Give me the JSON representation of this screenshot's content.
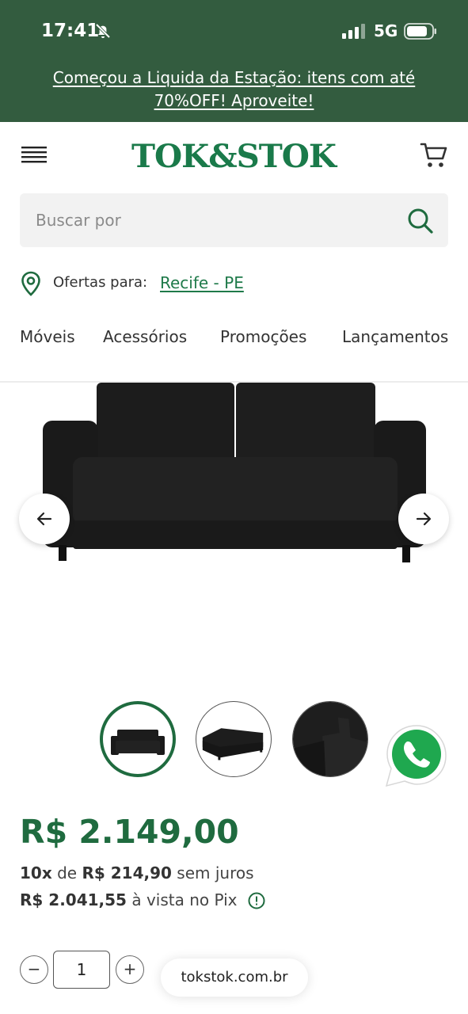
{
  "status_bar": {
    "time": "17:41",
    "network": "5G",
    "icons": [
      "bell-off-icon",
      "signal-icon",
      "battery-icon"
    ]
  },
  "promo_banner": {
    "text": "Começou a Liquida da Estação: itens com até 70%OFF! Aproveite!"
  },
  "header": {
    "logo": "TOK&STOK",
    "icons": [
      "menu-icon",
      "cart-icon"
    ]
  },
  "search": {
    "placeholder": "Buscar por",
    "value": ""
  },
  "location": {
    "label": "Ofertas para:",
    "city": "Recife - PE"
  },
  "nav": {
    "items": [
      "Móveis",
      "Acessórios",
      "Promoções",
      "Lançamentos"
    ]
  },
  "product": {
    "price": "R$ 2.149,00",
    "installments": {
      "count": "10x",
      "of": "de",
      "value": "R$ 214,90",
      "suffix": "sem juros"
    },
    "pix": {
      "value": "R$ 2.041,55",
      "suffix": "à vista no Pix"
    },
    "quantity": "1"
  },
  "browser": {
    "url": "tokstok.com.br"
  },
  "colors": {
    "brand_green": "#1f6b3f",
    "banner_green": "#335c3f",
    "link_green": "#1f7a4a"
  }
}
